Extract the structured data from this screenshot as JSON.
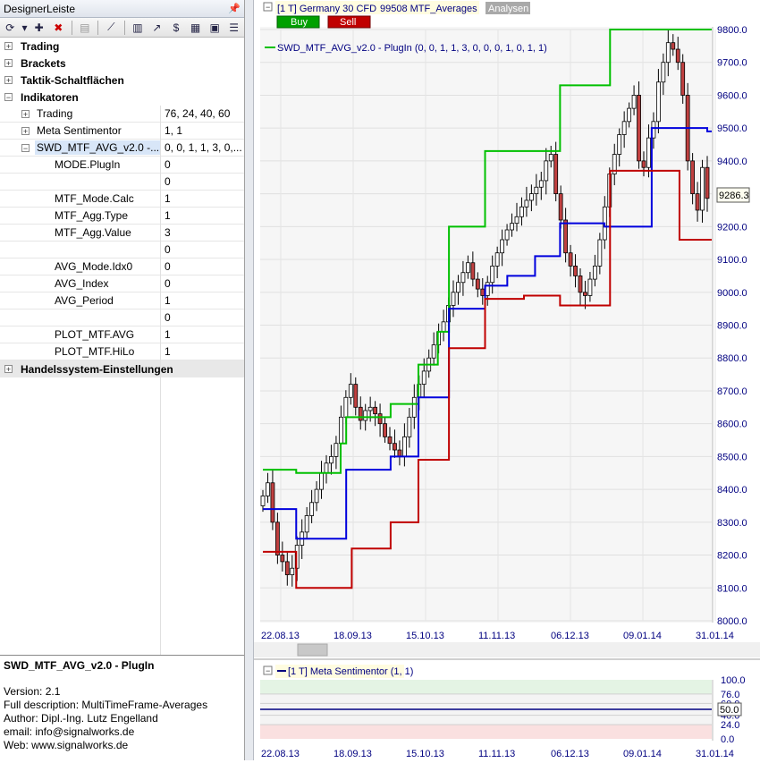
{
  "panel": {
    "title": "DesignerLeiste",
    "categories": [
      "Trading",
      "Brackets",
      "Taktik-Schaltflächen",
      "Indikatoren",
      "Handelssystem-Einstellungen"
    ],
    "indicators": [
      {
        "name": "Trading",
        "value": "76, 24, 40, 60"
      },
      {
        "name": "Meta Sentimentor",
        "value": "1, 1"
      },
      {
        "name": "SWD_MTF_AVG_v2.0 -...",
        "value": "0, 0, 1, 1, 3, 0,..."
      }
    ],
    "params": [
      {
        "name": "MODE.PlugIn",
        "value": "0"
      },
      {
        "name": "",
        "value": "0"
      },
      {
        "name": "MTF_Mode.Calc",
        "value": "1"
      },
      {
        "name": "MTF_Agg.Type",
        "value": "1"
      },
      {
        "name": "MTF_Agg.Value",
        "value": "3"
      },
      {
        "name": "",
        "value": "0"
      },
      {
        "name": "AVG_Mode.Idx0",
        "value": "0"
      },
      {
        "name": "AVG_Index",
        "value": "0"
      },
      {
        "name": "AVG_Period",
        "value": "1"
      },
      {
        "name": "",
        "value": "0"
      },
      {
        "name": "PLOT_MTF.AVG",
        "value": "1"
      },
      {
        "name": "PLOT_MTF.HiLo",
        "value": "1"
      }
    ]
  },
  "description": {
    "title": "SWD_MTF_AVG_v2.0 - PlugIn",
    "lines": [
      "Version: 2.1",
      "Full description: MultiTimeFrame-Averages",
      "Author: Dipl.-Ing. Lutz Engelland",
      "email: info@signalworks.de",
      "Web: www.signalworks.de"
    ]
  },
  "chart": {
    "header_instrument": "[1 T] Germany 30 CFD",
    "header_strategy": "99508 MTF_Averages",
    "header_tab": "Analysen",
    "buy_label": "Buy",
    "sell_label": "Sell",
    "legend": "SWD_MTF_AVG_v2.0 - PlugIn  (0, 0, 1, 1, 3, 0, 0, 0, 1, 0, 1, 1)",
    "last_price": "9286.3",
    "colors": {
      "green": "#00c000",
      "blue": "#0000dd",
      "red": "#c00000",
      "axis_text": "#000080"
    }
  },
  "sub": {
    "legend": "[1 T] Meta Sentimentor  (1, 1)",
    "current": "50.0"
  },
  "chart_data": [
    {
      "type": "candlestick",
      "ylim": [
        8000,
        9800
      ],
      "yticks": [
        "9800.0",
        "9700.0",
        "9600.0",
        "9500.0",
        "9400.0",
        "9300.0",
        "9200.0",
        "9100.0",
        "9000.0",
        "8900.0",
        "8800.0",
        "8700.0",
        "8600.0",
        "8500.0",
        "8400.0",
        "8300.0",
        "8200.0",
        "8100.0",
        "8000.0"
      ],
      "xticks": [
        "22.08.13",
        "18.09.13",
        "15.10.13",
        "11.11.13",
        "06.12.13",
        "09.01.14",
        "31.01.14"
      ],
      "close": [
        8380,
        8420,
        8300,
        8200,
        8180,
        8140,
        8160,
        8230,
        8270,
        8320,
        8360,
        8400,
        8450,
        8480,
        8500,
        8540,
        8620,
        8680,
        8720,
        8650,
        8610,
        8640,
        8650,
        8630,
        8600,
        8560,
        8540,
        8520,
        8500,
        8560,
        8620,
        8680,
        8720,
        8760,
        8800,
        8840,
        8880,
        8910,
        8960,
        9000,
        9030,
        9060,
        9090,
        9040,
        9010,
        8990,
        9030,
        9080,
        9120,
        9160,
        9190,
        9210,
        9230,
        9260,
        9280,
        9300,
        9320,
        9340,
        9400,
        9420,
        9300,
        9220,
        9120,
        9080,
        9050,
        9000,
        8990,
        9040,
        9080,
        9160,
        9260,
        9360,
        9420,
        9480,
        9520,
        9560,
        9600,
        9400,
        9380,
        9470,
        9520,
        9640,
        9700,
        9760,
        9740,
        9700,
        9600,
        9400,
        9300,
        9250,
        9380,
        9286
      ],
      "series": [
        {
          "name": "green",
          "color": "#00c000",
          "steps": [
            [
              0,
              8460
            ],
            [
              12,
              8450
            ],
            [
              28,
              8540
            ],
            [
              30,
              8620
            ],
            [
              46,
              8660
            ],
            [
              56,
              8780
            ],
            [
              63,
              8880
            ],
            [
              67,
              9200
            ],
            [
              80,
              9430
            ],
            [
              107,
              9630
            ],
            [
              125,
              9800
            ]
          ]
        },
        {
          "name": "blue",
          "color": "#0000dd",
          "steps": [
            [
              0,
              8340
            ],
            [
              12,
              8250
            ],
            [
              28,
              8250
            ],
            [
              30,
              8460
            ],
            [
              46,
              8500
            ],
            [
              56,
              8680
            ],
            [
              67,
              8950
            ],
            [
              80,
              9020
            ],
            [
              88,
              9050
            ],
            [
              98,
              9110
            ],
            [
              107,
              9210
            ],
            [
              123,
              9200
            ],
            [
              140,
              9500
            ],
            [
              160,
              9490
            ]
          ]
        },
        {
          "name": "red",
          "color": "#c00000",
          "steps": [
            [
              0,
              8210
            ],
            [
              12,
              8100
            ],
            [
              28,
              8100
            ],
            [
              32,
              8220
            ],
            [
              46,
              8300
            ],
            [
              56,
              8490
            ],
            [
              67,
              8830
            ],
            [
              80,
              8980
            ],
            [
              94,
              8990
            ],
            [
              107,
              8960
            ],
            [
              125,
              9370
            ],
            [
              150,
              9160
            ]
          ]
        }
      ]
    },
    {
      "type": "line",
      "ylim": [
        0,
        100
      ],
      "yticks": [
        "100.0",
        "76.0",
        "60.0",
        "50.0",
        "40.0",
        "24.0",
        "0.0"
      ],
      "xticks": [
        "22.08.13",
        "18.09.13",
        "15.10.13",
        "11.11.13",
        "06.12.13",
        "09.01.14",
        "31.01.14"
      ],
      "series": [
        {
          "name": "Meta Sentimentor",
          "values": [
            50
          ]
        }
      ]
    }
  ]
}
